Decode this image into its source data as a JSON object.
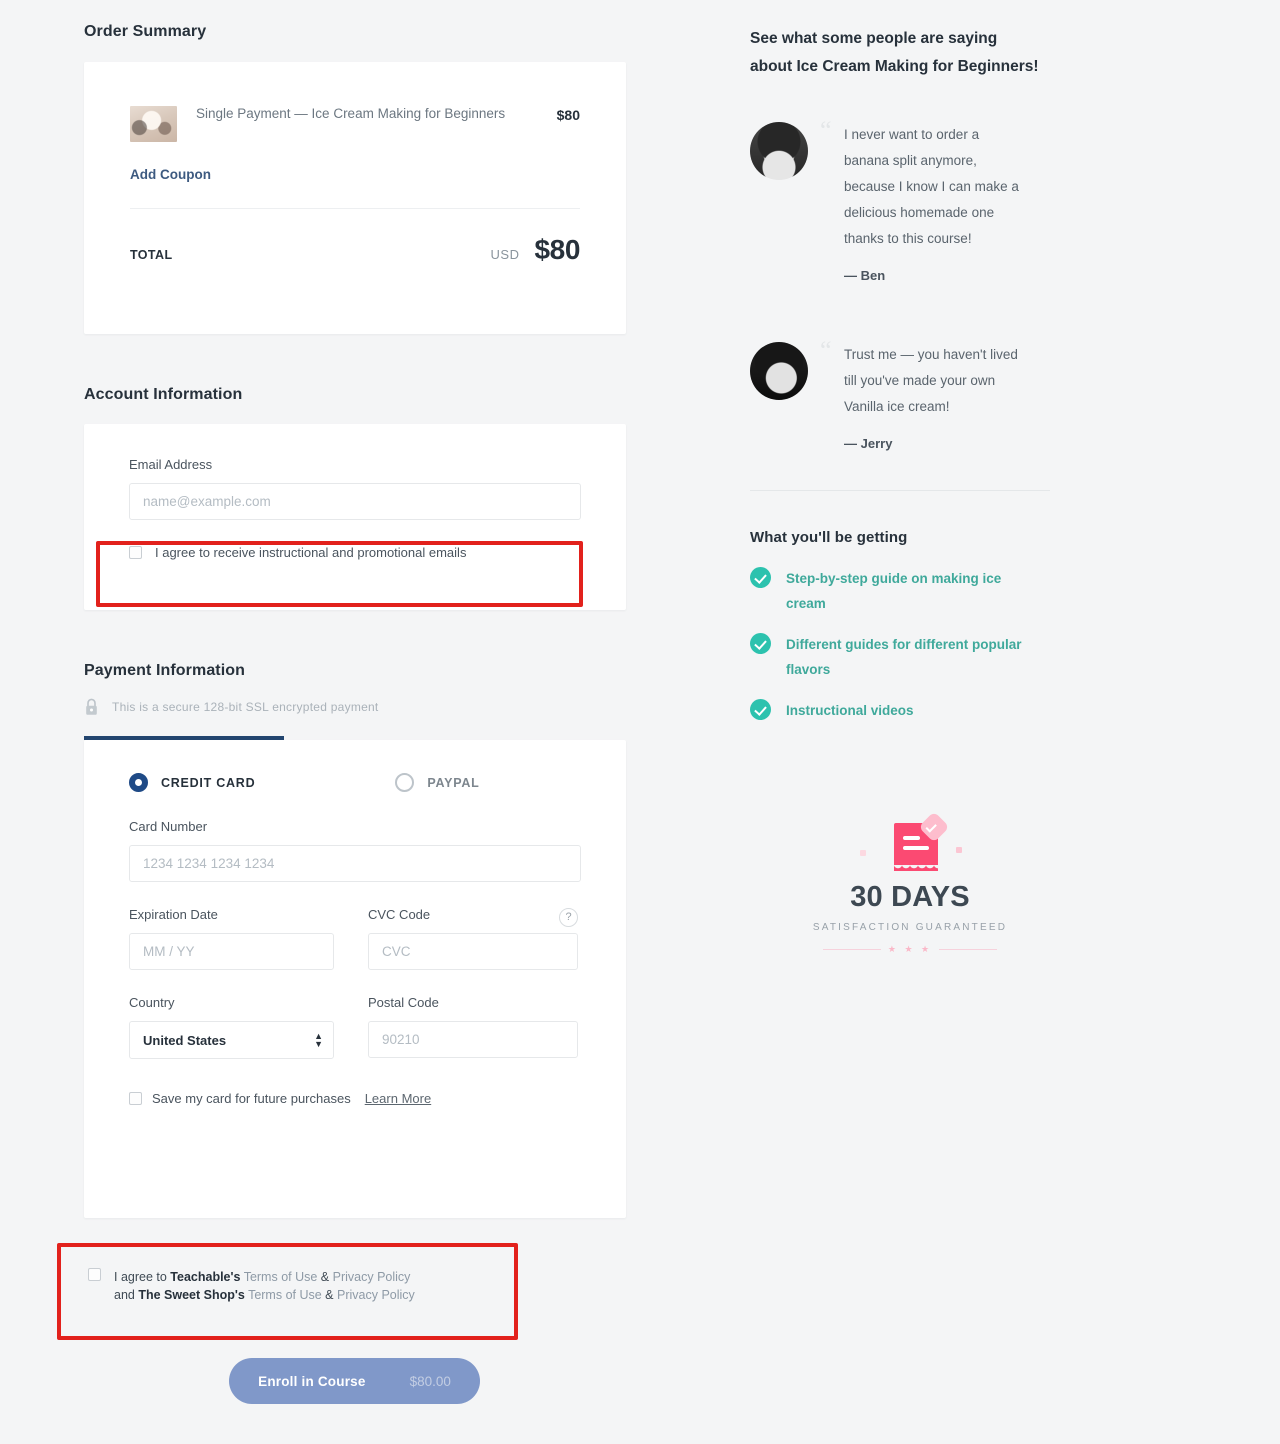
{
  "order_summary": {
    "title": "Order Summary",
    "item_name": "Single Payment — Ice Cream Making for Beginners",
    "item_price": "$80",
    "coupon_link": "Add Coupon",
    "total_label": "TOTAL",
    "total_currency": "USD",
    "total_amount": "$80"
  },
  "account": {
    "title": "Account Information",
    "email_label": "Email Address",
    "email_value": "",
    "email_placeholder": "name@example.com",
    "optin_label": "I agree to receive instructional and promotional emails"
  },
  "payment": {
    "title": "Payment Information",
    "ssl_notice": "This is a secure 128-bit SSL encrypted payment",
    "methods": [
      {
        "label": "CREDIT CARD",
        "selected": true
      },
      {
        "label": "PAYPAL",
        "selected": false
      }
    ],
    "card_number_label": "Card Number",
    "card_number_value": "",
    "card_number_placeholder": "1234 1234 1234 1234",
    "expiration_label": "Expiration Date",
    "expiration_value": "",
    "expiration_placeholder": "MM / YY",
    "cvc_label": "CVC Code",
    "cvc_value": "",
    "cvc_placeholder": "CVC",
    "cvc_help_glyph": "?",
    "country_label": "Country",
    "country_value": "United States",
    "postal_label": "Postal Code",
    "postal_value": "",
    "postal_placeholder": "90210",
    "save_card_label": "Save my card for future purchases",
    "learn_more_label": "Learn More"
  },
  "terms": {
    "line1_prefix": "I agree to ",
    "line1_brand": "Teachable's",
    "line1_terms": "Terms of Use",
    "amp": " & ",
    "line1_privacy": "Privacy Policy",
    "line2_prefix": "and ",
    "line2_brand": "The Sweet Shop's",
    "line2_terms": "Terms of Use",
    "line2_privacy": "Privacy Policy"
  },
  "enroll": {
    "label": "Enroll in Course",
    "price": "$80.00"
  },
  "sidebar": {
    "heading": "See what some people are saying about Ice Cream Making for Beginners!",
    "testimonials": [
      {
        "quote": "I never want to order a banana split anymore, because I know I can make a delicious homemade one thanks to this course!",
        "author": "— Ben"
      },
      {
        "quote": "Trust me — you haven't lived till you've made your own Vanilla ice cream!",
        "author": "— Jerry"
      }
    ],
    "benefits_title": "What you'll be getting",
    "benefits": [
      "Step-by-step guide on making ice cream",
      "Different guides for different popular flavors",
      "Instructional videos"
    ],
    "guarantee": {
      "title": "30 DAYS",
      "subtitle": "SATISFACTION GUARANTEED",
      "stars": "★ ★ ★"
    }
  },
  "colors": {
    "page_background": "#f4f5f6",
    "card_background": "#ffffff",
    "accent_navy": "#22456f",
    "link_navy": "#3d5a80",
    "teal": "#2cc2ae",
    "teal_text": "#3fa99b",
    "pink": "#fb4a72",
    "annotation_red": "#e2211c",
    "button_disabled": "#8098c9"
  }
}
